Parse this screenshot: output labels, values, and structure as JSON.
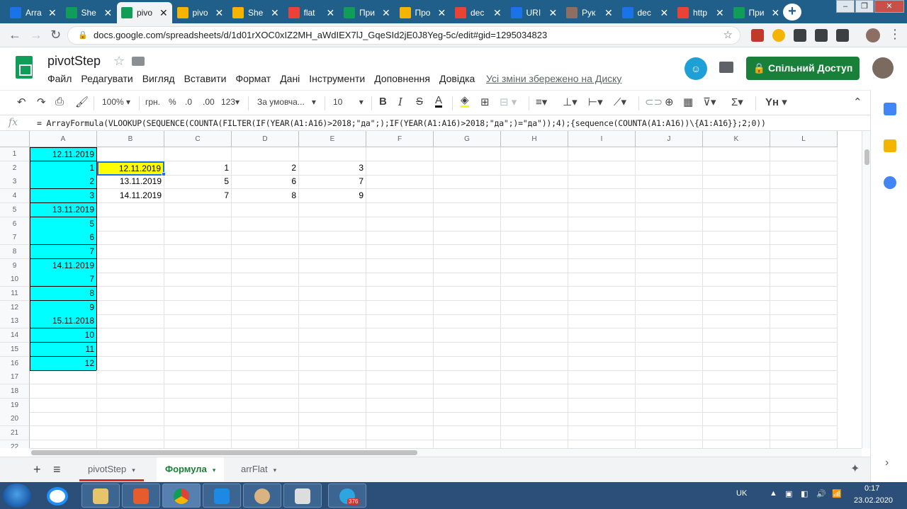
{
  "browser": {
    "tabs": [
      {
        "title": "Arra",
        "color": "#1a73e8",
        "active": false
      },
      {
        "title": "She",
        "color": "#0f9d58",
        "active": false
      },
      {
        "title": "pivo",
        "color": "#0f9d58",
        "active": true
      },
      {
        "title": "pivo",
        "color": "#f4b400",
        "active": false
      },
      {
        "title": "She",
        "color": "#f4b400",
        "active": false
      },
      {
        "title": "flat",
        "color": "#ea4335",
        "active": false
      },
      {
        "title": "При",
        "color": "#0f9d58",
        "active": false
      },
      {
        "title": "Про",
        "color": "#f4b400",
        "active": false
      },
      {
        "title": "dec",
        "color": "#ea4335",
        "active": false
      },
      {
        "title": "URI",
        "color": "#1a73e8",
        "active": false
      },
      {
        "title": "Рук",
        "color": "#8d6e63",
        "active": false
      },
      {
        "title": "dec",
        "color": "#1a73e8",
        "active": false
      },
      {
        "title": "http",
        "color": "#ea4335",
        "active": false
      },
      {
        "title": "При",
        "color": "#0f9d58",
        "active": false
      }
    ],
    "url": "docs.google.com/spreadsheets/d/1d01rXOC0xIZ2MH_aWdIEX7lJ_GqeSId2jE0J8Yeg-5c/edit#gid=1295034823"
  },
  "doc": {
    "title": "pivotStep",
    "menu": [
      "Файл",
      "Редагувати",
      "Вигляд",
      "Вставити",
      "Формат",
      "Дані",
      "Інструменти",
      "Доповнення",
      "Довідка"
    ],
    "saved_status": "Усі зміни збережено на Диску",
    "share_label": "Спільний Доступ"
  },
  "toolbar": {
    "zoom": "100%",
    "currency": "грн.",
    "percent": "%",
    "dec_less": ".0",
    "dec_more": ".00",
    "number_format": "123",
    "font": "За умовча...",
    "font_size": "10"
  },
  "formula_bar": {
    "fx": "fx",
    "formula": "= ArrayFormula(VLOOKUP(SEQUENCE(COUNTA(FILTER(IF(YEAR(A1:A16)>2018;\"да\";);IF(YEAR(A1:A16)>2018;\"да\";)=\"да\"));4);{sequence(COUNTA(A1:A16))\\{A1:A16}};2;0))"
  },
  "grid": {
    "columns": [
      "A",
      "B",
      "C",
      "D",
      "E",
      "F",
      "G",
      "H",
      "I",
      "J",
      "K",
      "L"
    ],
    "rows": [
      "1",
      "2",
      "3",
      "4",
      "5",
      "6",
      "7",
      "8",
      "9",
      "10",
      "11",
      "12",
      "13",
      "14",
      "15",
      "16",
      "17",
      "18",
      "19",
      "20",
      "21",
      "22"
    ],
    "column_a": [
      "12.11.2019",
      "1",
      "2",
      "3",
      "13.11.2019",
      "5",
      "6",
      "7",
      "14.11.2019",
      "7",
      "8",
      "9",
      "15.11.2018",
      "10",
      "11",
      "12"
    ],
    "result": [
      [
        "12.11.2019",
        "1",
        "2",
        "3"
      ],
      [
        "13.11.2019",
        "5",
        "6",
        "7"
      ],
      [
        "14.11.2019",
        "7",
        "8",
        "9"
      ]
    ],
    "highlight_color": "#00ffff",
    "selected_color": "#ffff00"
  },
  "sheets": {
    "add_icon": "+",
    "list_icon": "≡",
    "tabs": [
      {
        "label": "pivotStep",
        "active": false
      },
      {
        "label": "Формула",
        "active": true
      },
      {
        "label": "arrFlat",
        "active": false
      }
    ]
  },
  "taskbar": {
    "lang": "UK",
    "time": "0:17",
    "date": "23.02.2020",
    "telegram_badge": "376"
  }
}
